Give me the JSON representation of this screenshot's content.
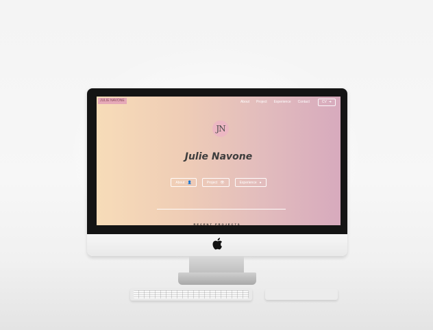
{
  "site": {
    "logo": "JULIE NAVONE",
    "nav": [
      "About",
      "Project",
      "Experience",
      "Contact"
    ],
    "cv_label": "CV",
    "cv_icon": "arrow-right-icon",
    "avatar_initials": "JN",
    "name": "Julie Navone",
    "hero_buttons": [
      {
        "label": "About",
        "icon": "user-icon"
      },
      {
        "label": "Project",
        "icon": "eye-icon"
      },
      {
        "label": "Experience",
        "icon": "circle-icon"
      }
    ],
    "section_title": "RECENT PROJECTS"
  },
  "colors": {
    "gradient_left": "#f7dcb8",
    "gradient_right": "#d7aabd",
    "avatar_bg": "#ecb7c3",
    "logo_bg": "#e6a9b8"
  }
}
